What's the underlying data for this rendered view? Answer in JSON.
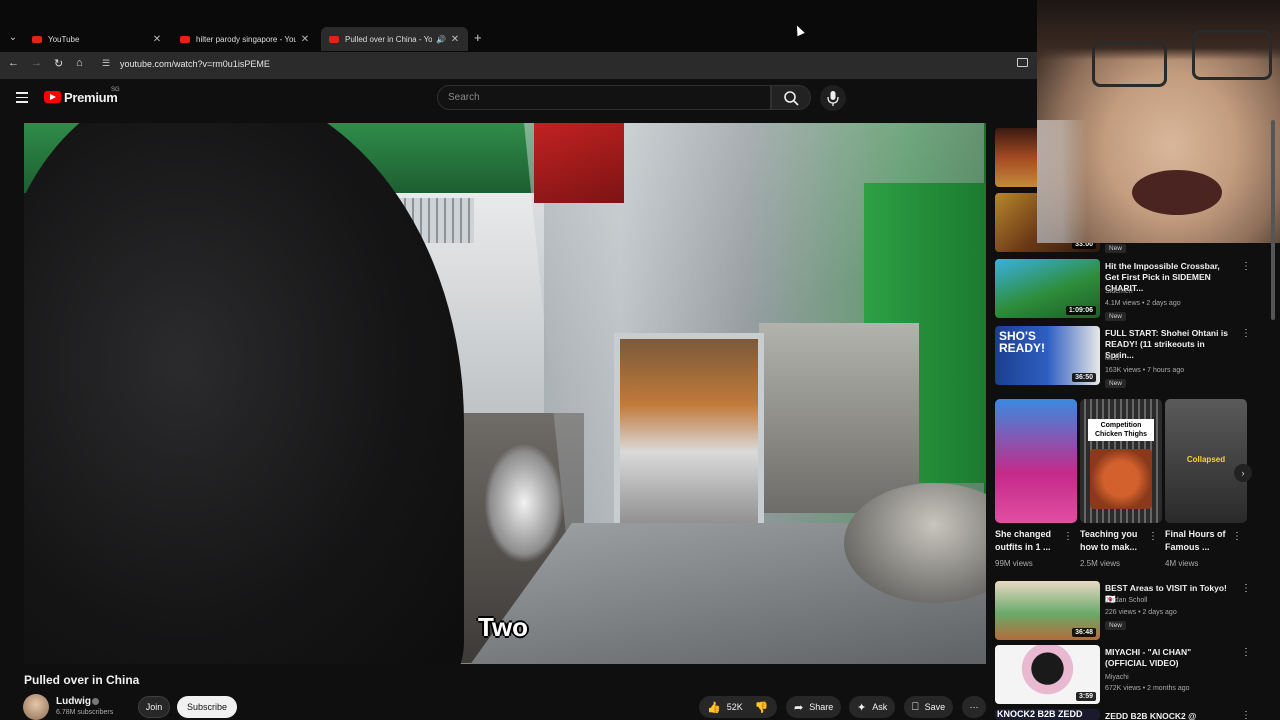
{
  "browser": {
    "tabs": [
      {
        "title": "YouTube"
      },
      {
        "title": "hilter parody singapore - YouTu"
      },
      {
        "title": "Pulled over in China - YouTu"
      }
    ],
    "url": "youtube.com/watch?v=rm0u1isPEME"
  },
  "header": {
    "logo": "Premium",
    "logo_sup": "SG",
    "search_placeholder": "Search"
  },
  "video": {
    "caption": "Two",
    "title": "Pulled over in China"
  },
  "channel": {
    "name": "Ludwig",
    "subscribers": "6.78M subscribers",
    "join": "Join",
    "subscribe": "Subscribe"
  },
  "actions": {
    "likes": "52K",
    "share": "Share",
    "ask": "Ask",
    "save": "Save"
  },
  "sidebar": {
    "top_duration": "33:00",
    "top_new": "New",
    "items": [
      {
        "title": "Hit the Impossible Crossbar, Get First Pick in SIDEMEN CHARIT...",
        "channel": "Sidemen",
        "meta": "4.1M views • 2 days ago",
        "duration": "1:09:06",
        "badge": "New"
      },
      {
        "title": "FULL START: Shohei Ohtani is READY! (11 strikeouts in Sprin...",
        "channel": "MLB",
        "meta": "163K views • 7 hours ago",
        "duration": "36:50",
        "badge": "New"
      },
      {
        "title": "BEST Areas to VISIT in Tokyo! 🇯🇵",
        "channel": "Jordan Scholl",
        "meta": "226 views • 2 days ago",
        "duration": "36:48",
        "badge": "New"
      },
      {
        "title": "MIYACHI - \"AI CHAN\" (OFFICIAL VIDEO)",
        "channel": "Miyachi",
        "meta": "672K views • 2 months ago",
        "duration": "3:59"
      },
      {
        "title": "ZEDD B2B KNOCK2 @"
      }
    ],
    "shorts": [
      {
        "title": "She changed outfits in 1 ...",
        "views": "99M views"
      },
      {
        "title": "Teaching you how to mak...",
        "views": "2.5M views",
        "overlay": "Competition Chicken Thighs"
      },
      {
        "title": "Final Hours of Famous ...",
        "views": "4M views",
        "overlay": "Collapsed"
      }
    ],
    "thumb_texts": {
      "shos": "SHO'S READY!",
      "knock": "KNOCK2 B2B ZEDD"
    }
  },
  "colors": {
    "brand": "#ff0000",
    "background": "#0f0f0f"
  }
}
